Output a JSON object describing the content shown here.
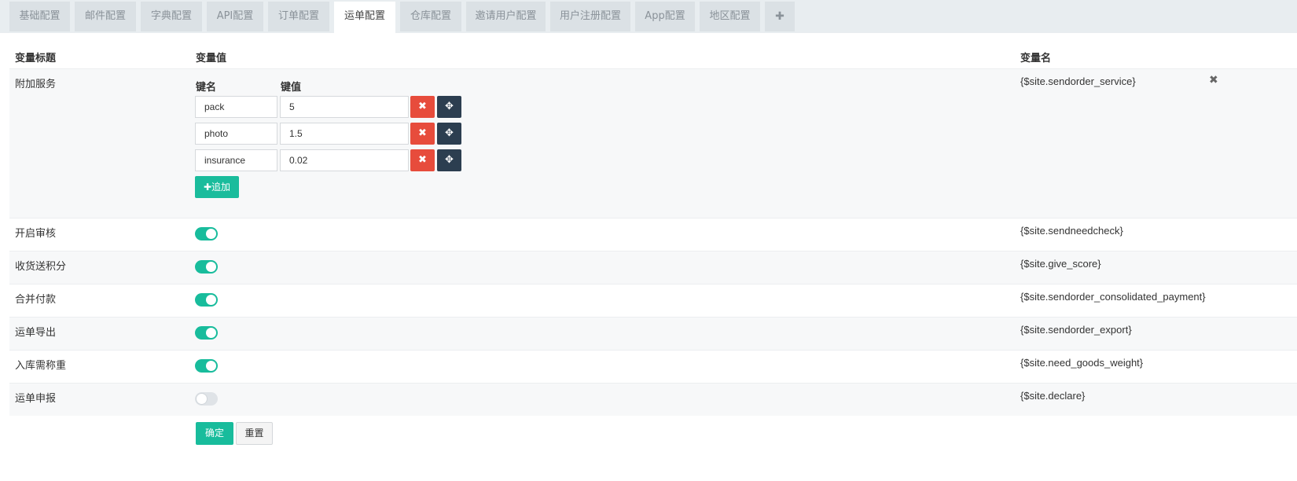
{
  "tabs": [
    {
      "label": "基础配置",
      "active": false
    },
    {
      "label": "邮件配置",
      "active": false
    },
    {
      "label": "字典配置",
      "active": false
    },
    {
      "label": "API配置",
      "active": false
    },
    {
      "label": "订单配置",
      "active": false
    },
    {
      "label": "运单配置",
      "active": true
    },
    {
      "label": "仓库配置",
      "active": false
    },
    {
      "label": "邀请用户配置",
      "active": false
    },
    {
      "label": "用户注册配置",
      "active": false
    },
    {
      "label": "App配置",
      "active": false
    },
    {
      "label": "地区配置",
      "active": false
    }
  ],
  "add_tab_icon": "plus-icon",
  "table": {
    "headers": {
      "title": "变量标题",
      "value": "变量值",
      "name": "变量名"
    },
    "kv_row": {
      "title": "附加服务",
      "var": "{$site.sendorder_service}",
      "key_header": "键名",
      "value_header": "键值",
      "items": [
        {
          "key": "pack",
          "value": "5"
        },
        {
          "key": "photo",
          "value": "1.5"
        },
        {
          "key": "insurance",
          "value": "0.02"
        }
      ],
      "add_label": "追加",
      "close_icon": "close-icon"
    },
    "switch_rows": [
      {
        "title": "开启审核",
        "var": "{$site.sendneedcheck}",
        "on": true
      },
      {
        "title": "收货送积分",
        "var": "{$site.give_score}",
        "on": true
      },
      {
        "title": "合并付款",
        "var": "{$site.sendorder_consolidated_payment}",
        "on": true
      },
      {
        "title": "运单导出",
        "var": "{$site.sendorder_export}",
        "on": true
      },
      {
        "title": "入库需称重",
        "var": "{$site.need_goods_weight}",
        "on": true
      },
      {
        "title": "运单申报",
        "var": "{$site.declare}",
        "on": false
      }
    ]
  },
  "buttons": {
    "ok": "确定",
    "reset": "重置"
  },
  "colors": {
    "accent": "#18bc9c",
    "danger": "#e74c3c",
    "dark": "#2c3e50"
  }
}
